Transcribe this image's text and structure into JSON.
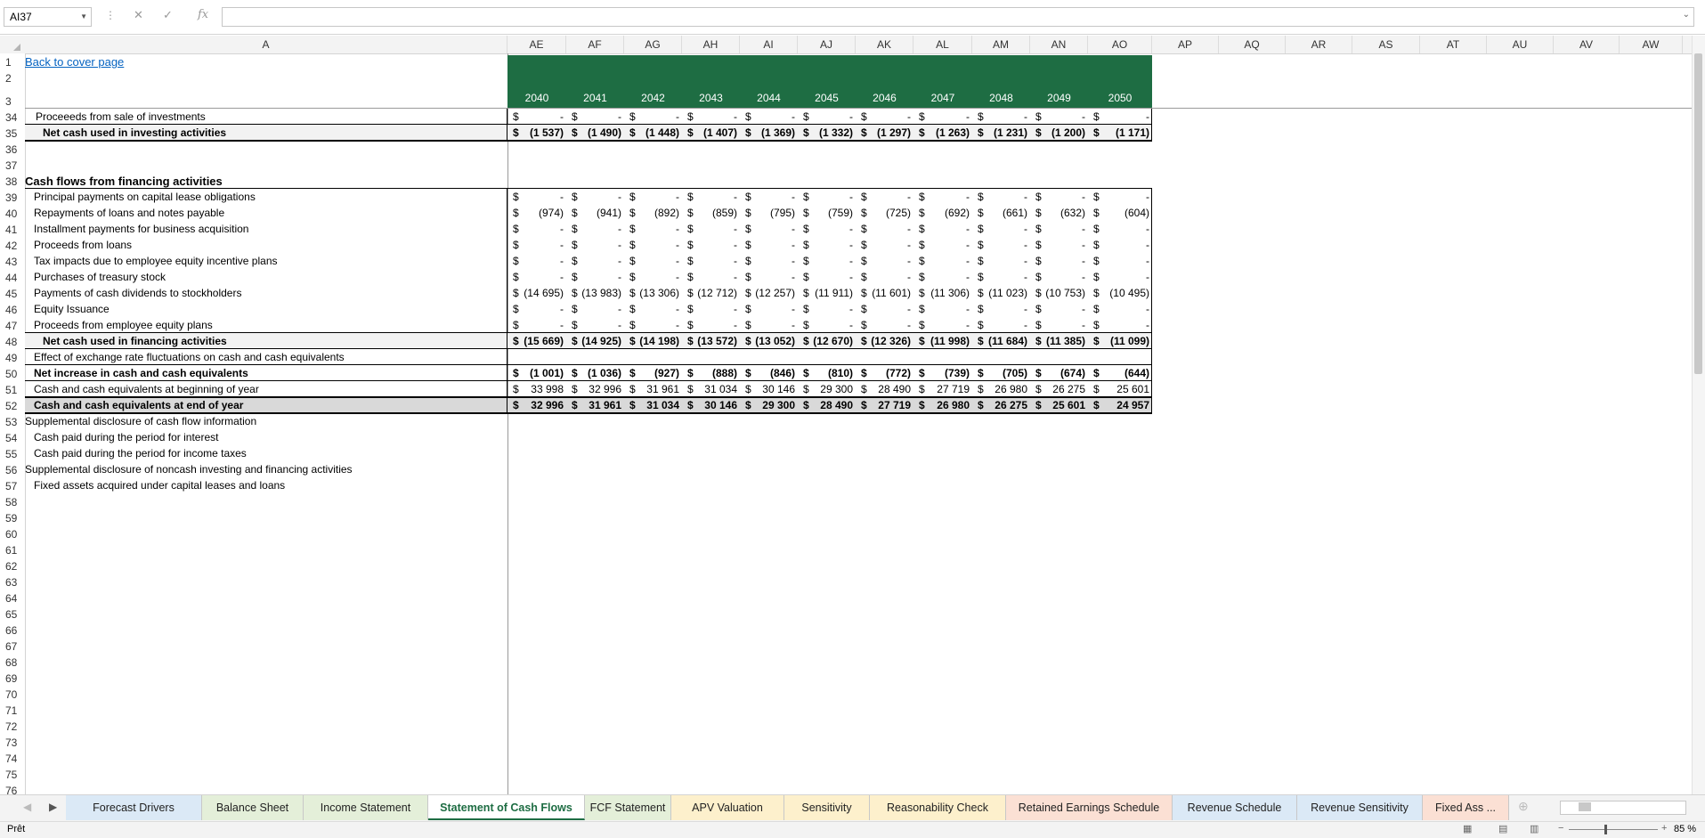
{
  "formula_bar": {
    "name_box": "AI37",
    "formula": ""
  },
  "columns": [
    "A",
    "AE",
    "AF",
    "AG",
    "AH",
    "AI",
    "AJ",
    "AK",
    "AL",
    "AM",
    "AN",
    "AO",
    "AP",
    "AQ",
    "AR",
    "AS",
    "AT",
    "AU",
    "AV",
    "AW"
  ],
  "rows": [
    "1",
    "2",
    "3",
    "34",
    "35",
    "36",
    "37",
    "38",
    "39",
    "40",
    "41",
    "42",
    "43",
    "44",
    "45",
    "46",
    "47",
    "48",
    "49",
    "50",
    "51",
    "52",
    "53",
    "54",
    "55",
    "56",
    "57",
    "58",
    "59",
    "60",
    "61",
    "62",
    "63",
    "64",
    "65",
    "66",
    "67",
    "68",
    "69",
    "70",
    "71",
    "72",
    "73",
    "74",
    "75",
    "76"
  ],
  "link": "Back to cover page",
  "years": [
    "2040",
    "2041",
    "2042",
    "2043",
    "2044",
    "2045",
    "2046",
    "2047",
    "2048",
    "2049",
    "2050"
  ],
  "currency": "$",
  "lines": [
    {
      "label": "Proceeeds from sale of investments",
      "values": [
        "-",
        "-",
        "-",
        "-",
        "-",
        "-",
        "-",
        "-",
        "-",
        "-",
        "-"
      ]
    },
    {
      "label": "Net cash used in investing activities",
      "values": [
        "(1 537)",
        "(1 490)",
        "(1 448)",
        "(1 407)",
        "(1 369)",
        "(1 332)",
        "(1 297)",
        "(1 263)",
        "(1 231)",
        "(1 200)",
        "(1 171)"
      ]
    },
    {
      "label": "",
      "values": []
    },
    {
      "label": "",
      "values": []
    },
    {
      "label": "Cash flows from financing activities",
      "values": []
    },
    {
      "label": "Principal payments on capital lease obligations",
      "values": [
        "-",
        "-",
        "-",
        "-",
        "-",
        "-",
        "-",
        "-",
        "-",
        "-",
        "-"
      ]
    },
    {
      "label": "Repayments of loans and notes payable",
      "values": [
        "(974)",
        "(941)",
        "(892)",
        "(859)",
        "(795)",
        "(759)",
        "(725)",
        "(692)",
        "(661)",
        "(632)",
        "(604)"
      ]
    },
    {
      "label": "Installment payments for business acquisition",
      "values": [
        "-",
        "-",
        "-",
        "-",
        "-",
        "-",
        "-",
        "-",
        "-",
        "-",
        "-"
      ]
    },
    {
      "label": "Proceeds from loans",
      "values": [
        "-",
        "-",
        "-",
        "-",
        "-",
        "-",
        "-",
        "-",
        "-",
        "-",
        "-"
      ]
    },
    {
      "label": "Tax impacts due to employee equity incentive plans",
      "values": [
        "-",
        "-",
        "-",
        "-",
        "-",
        "-",
        "-",
        "-",
        "-",
        "-",
        "-"
      ]
    },
    {
      "label": "Purchases of treasury stock",
      "values": [
        "-",
        "-",
        "-",
        "-",
        "-",
        "-",
        "-",
        "-",
        "-",
        "-",
        "-"
      ]
    },
    {
      "label": "Payments of cash dividends to stockholders",
      "values": [
        "(14 695)",
        "(13 983)",
        "(13 306)",
        "(12 712)",
        "(12 257)",
        "(11 911)",
        "(11 601)",
        "(11 306)",
        "(11 023)",
        "(10 753)",
        "(10 495)"
      ]
    },
    {
      "label": "Equity Issuance",
      "values": [
        "-",
        "-",
        "-",
        "-",
        "-",
        "-",
        "-",
        "-",
        "-",
        "-",
        "-"
      ]
    },
    {
      "label": "Proceeds from employee equity plans",
      "values": [
        "-",
        "-",
        "-",
        "-",
        "-",
        "-",
        "-",
        "-",
        "-",
        "-",
        "-"
      ]
    },
    {
      "label": "Net cash used in financing activities",
      "values": [
        "(15 669)",
        "(14 925)",
        "(14 198)",
        "(13 572)",
        "(13 052)",
        "(12 670)",
        "(12 326)",
        "(11 998)",
        "(11 684)",
        "(11 385)",
        "(11 099)"
      ]
    },
    {
      "label": "Effect of exchange rate fluctuations on cash and cash equivalents",
      "values": []
    },
    {
      "label": "Net increase in cash and cash equivalents",
      "values": [
        "(1 001)",
        "(1 036)",
        "(927)",
        "(888)",
        "(846)",
        "(810)",
        "(772)",
        "(739)",
        "(705)",
        "(674)",
        "(644)"
      ]
    },
    {
      "label": "Cash and cash equivalents at beginning of year",
      "values": [
        "33 998",
        "32 996",
        "31 961",
        "31 034",
        "30 146",
        "29 300",
        "28 490",
        "27 719",
        "26 980",
        "26 275",
        "25 601"
      ]
    },
    {
      "label": "Cash and cash equivalents at end of year",
      "values": [
        "32 996",
        "31 961",
        "31 034",
        "30 146",
        "29 300",
        "28 490",
        "27 719",
        "26 980",
        "26 275",
        "25 601",
        "24 957"
      ]
    },
    {
      "label": "Supplemental disclosure of cash flow information",
      "values": []
    },
    {
      "label": "Cash paid during the period for interest",
      "values": []
    },
    {
      "label": "Cash paid during the period for income taxes",
      "values": []
    },
    {
      "label": "Supplemental disclosure of noncash investing and financing activities",
      "values": []
    },
    {
      "label": "Fixed assets acquired under capital leases and loans",
      "values": []
    }
  ],
  "tabs": [
    "Forecast Drivers",
    "Balance Sheet",
    "Income Statement",
    "Statement of Cash Flows",
    "FCF Statement",
    "APV Valuation",
    "Sensitivity",
    "Reasonability Check",
    "Retained Earnings Schedule",
    "Revenue Schedule",
    "Revenue Sensitivity",
    "Fixed Ass ..."
  ],
  "active_tab": "Statement of Cash Flows",
  "tab_colors": [
    "#dbe9f6",
    "#e4efd9",
    "#e4efd9",
    "#e4efd9",
    "#e4efd9",
    "#fdf0cc",
    "#fdf0cc",
    "#fdf0cc",
    "#fbe0d4",
    "#dbe9f6",
    "#dbe9f6",
    "#fbe0d4"
  ],
  "status": {
    "ready": "Prêt",
    "zoom": "85 %"
  },
  "colors": {
    "header_green": "#1e6d43",
    "link": "#0563c1",
    "total_fill": "#d9d9d9"
  }
}
